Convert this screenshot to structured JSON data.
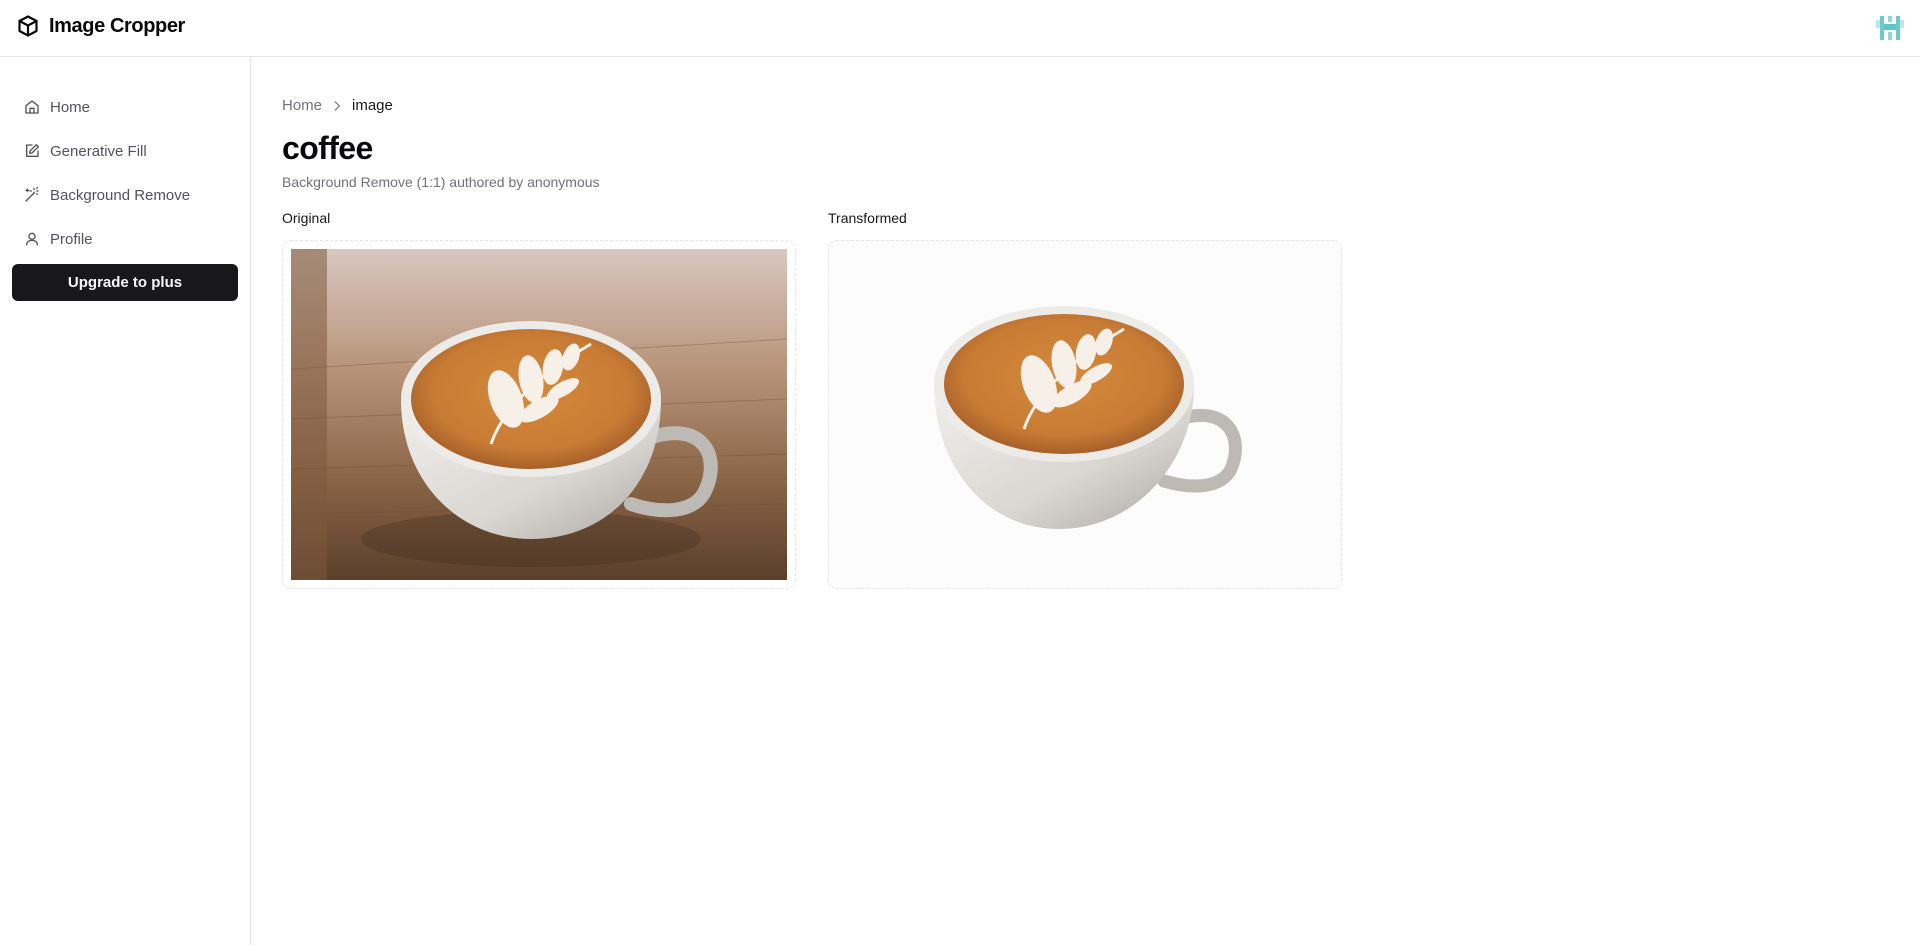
{
  "app": {
    "name": "Image Cropper",
    "logo_icon": "cube-icon"
  },
  "sidebar": {
    "items": [
      {
        "label": "Home",
        "icon": "home-icon"
      },
      {
        "label": "Generative Fill",
        "icon": "edit-square-icon"
      },
      {
        "label": "Background Remove",
        "icon": "magic-wand-icon"
      },
      {
        "label": "Profile",
        "icon": "user-icon"
      }
    ],
    "upgrade_label": "Upgrade to plus"
  },
  "breadcrumb": {
    "home": "Home",
    "current": "image"
  },
  "page": {
    "title": "coffee",
    "subtitle": "Background Remove (1:1) authored by anonymous"
  },
  "panels": {
    "original_label": "Original",
    "transformed_label": "Transformed"
  },
  "colors": {
    "primary_button": "#18181b",
    "border": "#e4e4e7",
    "muted_text": "#71717a",
    "avatar_accent": "#5ec4c4"
  }
}
